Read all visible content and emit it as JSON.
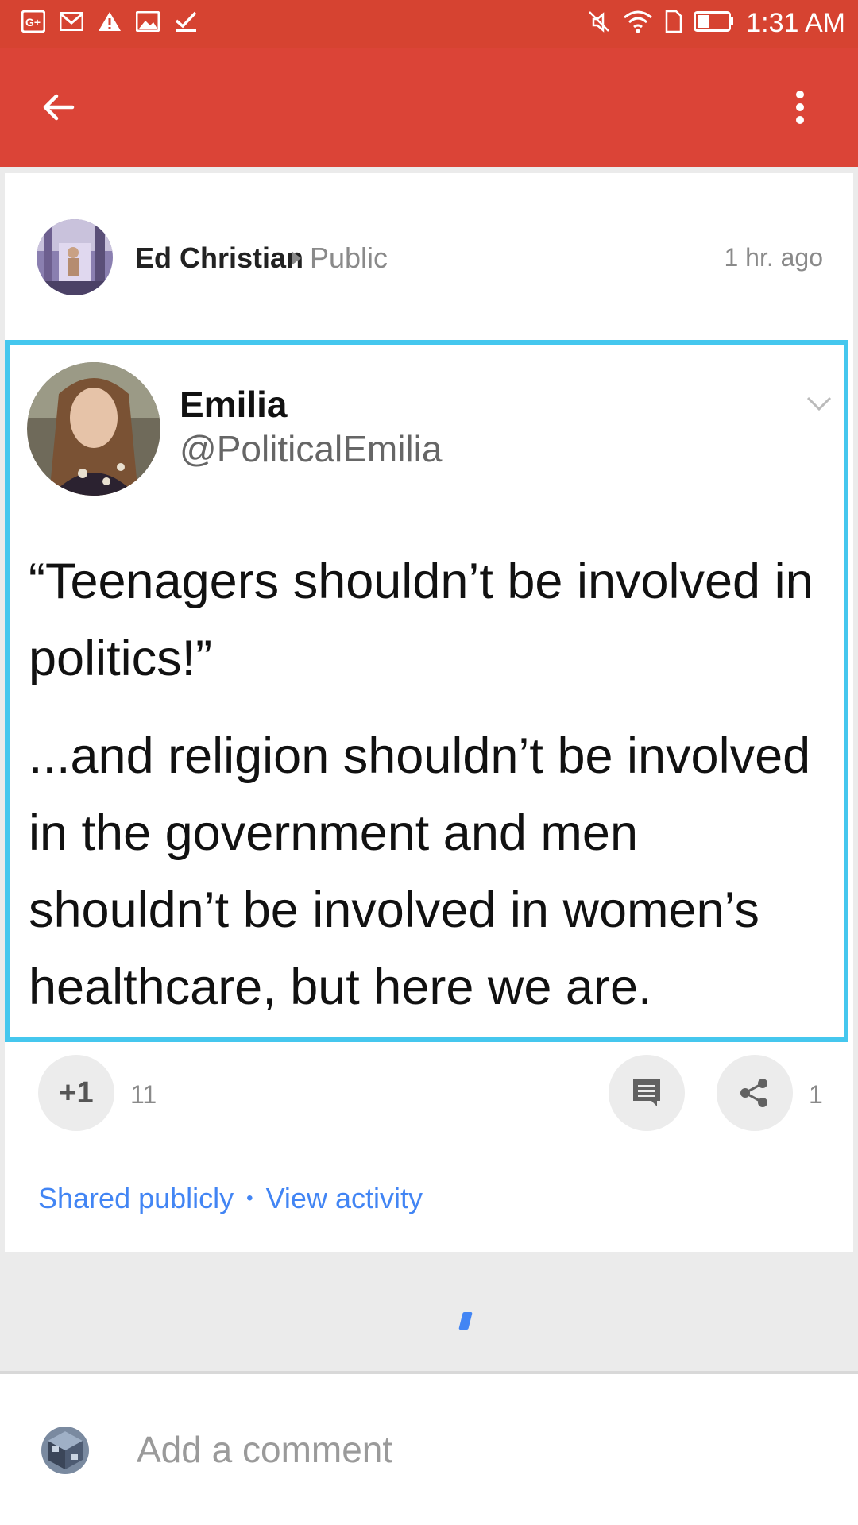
{
  "status_bar": {
    "left_icons": [
      "google-plus-icon",
      "gmail-icon",
      "warning-icon",
      "image-icon",
      "checkmark-icon"
    ],
    "right_icons": [
      "mute-icon",
      "wifi-icon",
      "sim-icon",
      "battery-icon"
    ],
    "time": "1:31 AM"
  },
  "app_bar": {
    "back_icon": "arrow-back-icon",
    "more_icon": "more-vert-icon",
    "color": "#db4437"
  },
  "post": {
    "author": "Ed Christian",
    "visibility": "Public",
    "time": "1 hr. ago",
    "tweet": {
      "name": "Emilia",
      "handle": "@PoliticalEmilia",
      "paragraphs": [
        "“Teenagers shouldn’t be involved in politics!”",
        "...and religion shouldn’t be involved in the government and men shouldn’t be involved in women’s healthcare, but here we are."
      ],
      "border_color": "#45c7ee"
    },
    "plus_label": "+1",
    "plus_count": "11",
    "share_count": "1",
    "shared_publicly": "Shared publicly",
    "separator": "•",
    "view_activity": "View activity"
  },
  "comment_bar": {
    "placeholder": "Add a comment"
  },
  "colors": {
    "link": "#4285f4",
    "spinner": "#4285f4"
  }
}
